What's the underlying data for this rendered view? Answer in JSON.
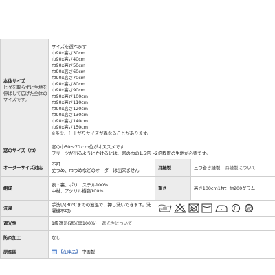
{
  "rows": {
    "body_size": {
      "label": "本体サイズ",
      "sublabel": "ヒダを取らずに生地を伸ばして広げた全体のサイズです。",
      "sizes": [
        "サイズを選べます",
        "巾90x高さ30cm",
        "巾90x高さ40cm",
        "巾90x高さ50cm",
        "巾90x高さ60cm",
        "巾90x高さ70cm",
        "巾90x高さ80cm",
        "巾90x高さ90cm",
        "巾90x高さ100cm",
        "巾90x高さ110cm",
        "巾90x高さ120cm",
        "巾90x高さ130cm",
        "巾90x高さ140cm",
        "巾90x高さ150cm"
      ],
      "note": "※多少、仕上がりサイズが異なることがあります。"
    },
    "window_size": {
      "label": "窓のサイズ（巾）",
      "line1": "窓の巾50～70ｃｍ位がオススメです",
      "line2": "プリーツが出るようにかけるには、窓の巾の1.5倍～2倍程度の生地が必要です。"
    },
    "order": {
      "label": "オーダーサイズ対応",
      "line1": "不可",
      "line2": "丈つめ、巾つめなどのオーダーは出来ません",
      "seam_label": "耳縫製",
      "seam_value": "三つ巻き縫製",
      "seam_link": "耳縫製について"
    },
    "composition": {
      "label": "組成",
      "line1": "表・裏：ポリエステル100%",
      "line2": "中材：アクリル樹脂100%",
      "weight_label": "重さ",
      "weight_value": "高さ100cm1枚：約200グラム"
    },
    "wash": {
      "label": "洗濯",
      "text": "手洗い(30℃までの液温で、押し洗いできます。洗濯機不可)",
      "icons": [
        "hand-wash-icon",
        "no-bleach-icon",
        "tumble-dry-icon",
        "line-dry-icon",
        "iron-icon",
        "dry-clean-icon",
        "wet-clean-icon"
      ]
    },
    "blackout": {
      "label": "遮光性",
      "text": "1級遮光(遮光率100%)",
      "link": "遮光性について"
    },
    "flame": {
      "label": "防炎加工",
      "text": "なし"
    },
    "origin": {
      "label": "原産国",
      "stock": "【在庫品】",
      "text": "中国製"
    }
  },
  "colors": {
    "header_bg": "#ececec",
    "border": "#cfcfcf",
    "link": "#2a5db0"
  }
}
